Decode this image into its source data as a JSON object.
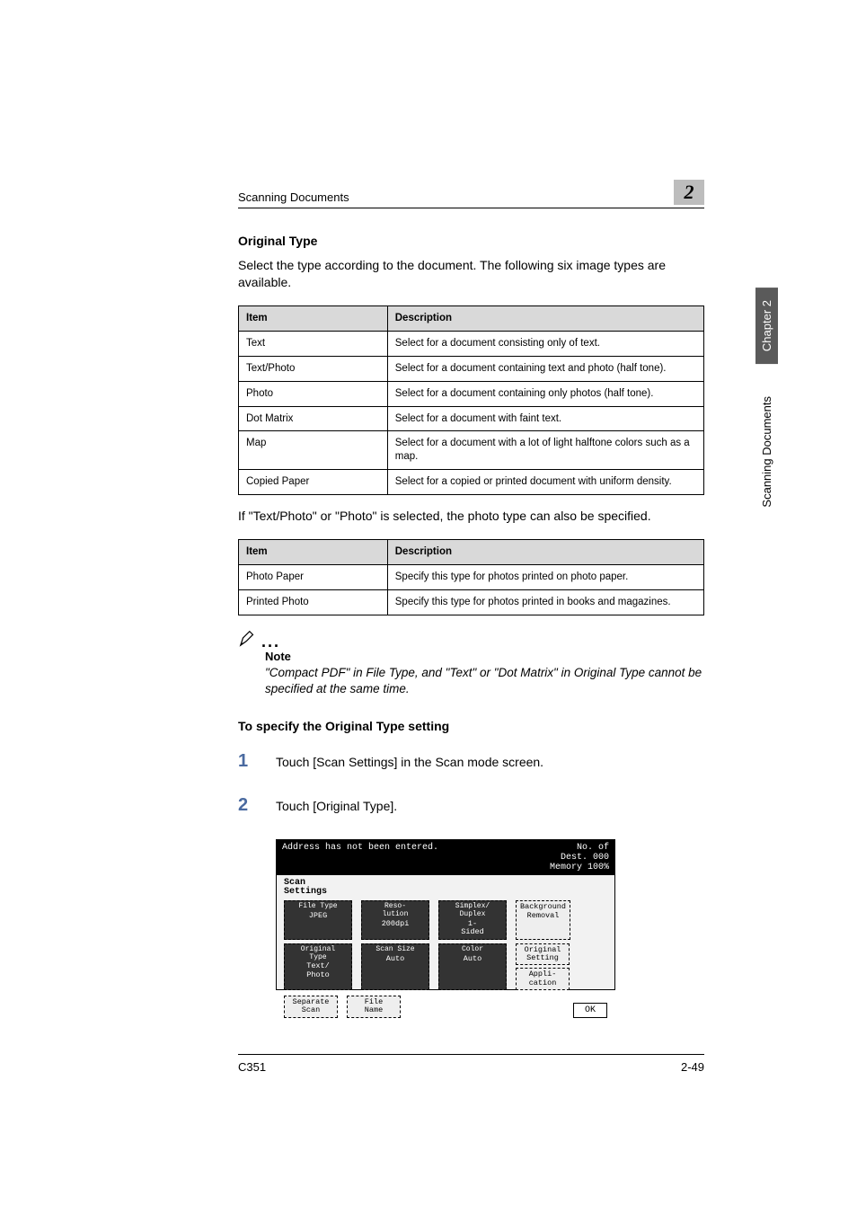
{
  "running_header": "Scanning Documents",
  "chapter_number_box": "2",
  "heading": "Original Type",
  "intro": "Select the type according to the document. The following six image types are available.",
  "table1": {
    "headers": [
      "Item",
      "Description"
    ],
    "rows": [
      [
        "Text",
        "Select for a document consisting only of text."
      ],
      [
        "Text/Photo",
        "Select for a document containing text and photo (half tone)."
      ],
      [
        "Photo",
        "Select for a document containing only photos (half tone)."
      ],
      [
        "Dot Matrix",
        "Select for a document with faint text."
      ],
      [
        "Map",
        "Select for a document with a lot of light halftone colors such as a map."
      ],
      [
        "Copied Paper",
        "Select for a copied or printed document with uniform density."
      ]
    ]
  },
  "after_table1": "If \"Text/Photo\" or \"Photo\" is selected, the photo type can also be specified.",
  "table2": {
    "headers": [
      "Item",
      "Description"
    ],
    "rows": [
      [
        "Photo Paper",
        "Specify this type for photos printed on photo paper."
      ],
      [
        "Printed Photo",
        "Specify this type for photos printed in books and magazines."
      ]
    ]
  },
  "note": {
    "label": "Note",
    "body": "\"Compact PDF\" in File Type, and \"Text\" or \"Dot Matrix\" in Original Type cannot be specified at the same time."
  },
  "procedure_title": "To specify the Original Type setting",
  "steps": [
    {
      "num": "1",
      "text": "Touch [Scan Settings] in the Scan mode screen."
    },
    {
      "num": "2",
      "text": "Touch [Original Type]."
    }
  ],
  "panel": {
    "status": "Address has not been entered.",
    "dest_label": "No. of\nDest.",
    "dest_count": "000",
    "memory": "Memory 100%",
    "tab": "Scan\nSettings",
    "buttons": {
      "file_type": {
        "top": "File Type",
        "val": "JPEG"
      },
      "resolution": {
        "top": "Reso-\nlution",
        "val": "200dpi"
      },
      "duplex": {
        "top": "Simplex/\nDuplex",
        "val": "1-\nSided"
      },
      "background": "Background\nRemoval",
      "original_type": {
        "top": "Original\nType",
        "val": "Text/\nPhoto"
      },
      "scan_size": {
        "top": "Scan Size",
        "val": "Auto"
      },
      "color": {
        "top": "Color",
        "val": "Auto"
      },
      "original_setting": "Original\nSetting",
      "application": "Appli-\ncation",
      "separate_scan": "Separate\nScan",
      "file_name": "File\nName",
      "ok": "OK"
    }
  },
  "side_tabs": {
    "chapter": "Chapter 2",
    "section": "Scanning Documents"
  },
  "footer": {
    "left": "C351",
    "right": "2-49"
  }
}
